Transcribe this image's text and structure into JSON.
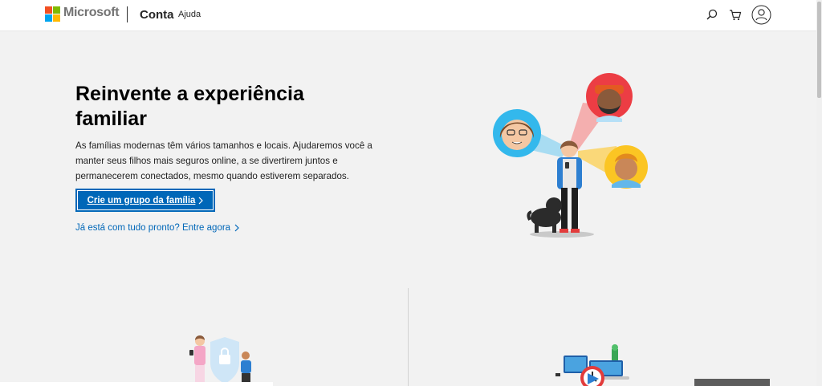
{
  "header": {
    "brand": "Microsoft",
    "nav": {
      "conta": "Conta",
      "ajuda": "Ajuda"
    },
    "icons": [
      "search-icon",
      "cart-icon",
      "profile-icon"
    ],
    "logo_colors": [
      "#f25022",
      "#7fba00",
      "#00a4ef",
      "#ffb900"
    ]
  },
  "hero": {
    "title": "Reinvente a experiência familiar",
    "description": "As famílias modernas têm vários tamanhos e locais. Ajudaremos você a manter seus filhos mais seguros online, a se divertirem juntos e permanecerem conectados, mesmo quando estiverem separados.",
    "cta_label": "Crie um grupo da família",
    "signin_label": "Já está com tudo pronto? Entre agora"
  },
  "colors": {
    "accent": "#0067b8",
    "page_background": "#f2f2f2",
    "header_background": "#ffffff"
  }
}
